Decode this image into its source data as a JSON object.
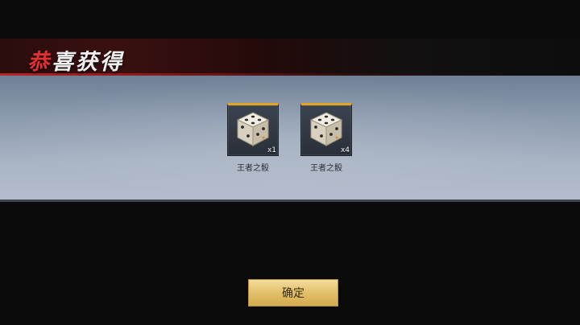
{
  "banner": {
    "title_first": "恭",
    "title_rest": "喜获得"
  },
  "rewards": [
    {
      "name": "王者之骰",
      "quantity": "x1",
      "icon": "dice-icon"
    },
    {
      "name": "王者之骰",
      "quantity": "x4",
      "icon": "dice-icon"
    }
  ],
  "confirm_button": {
    "label": "确定"
  },
  "colors": {
    "accent_red": "#e03030",
    "item_border_gold": "#e6a520",
    "button_gold": "#e2c06a"
  }
}
